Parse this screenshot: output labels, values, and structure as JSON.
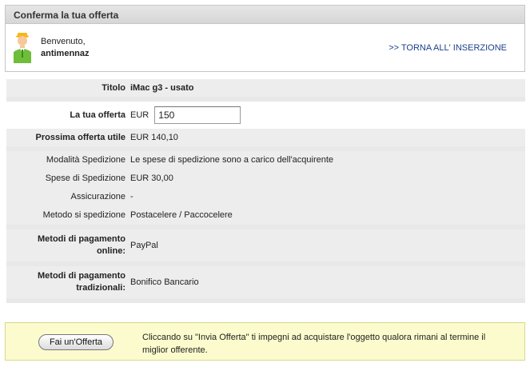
{
  "header": {
    "title": "Conferma la tua offerta"
  },
  "welcome": {
    "greeting": "Benvenuto,",
    "username": "antimennaz",
    "back_link": ">> TORNA ALL' INSERZIONE",
    "avatar_icon": "user-avatar-icon"
  },
  "details": {
    "titolo": {
      "label": "Titolo",
      "value": "iMac g3 - usato"
    },
    "offerta": {
      "label": "La tua offerta",
      "currency": "EUR",
      "input_value": "150"
    },
    "prossima": {
      "label": "Prossima offerta utile",
      "value": "EUR 140,10"
    },
    "modalita": {
      "label": "Modalità Spedizione",
      "value": "Le spese di spedizione sono a carico dell'acquirente"
    },
    "spese": {
      "label": "Spese di Spedizione",
      "value": "EUR 30,00"
    },
    "assicurazione": {
      "label": "Assicurazione",
      "value": "-"
    },
    "metodo": {
      "label": "Metodo si spedizione",
      "value": "Postacelere / Paccocelere"
    },
    "pagamento_online": {
      "label": "Metodi di pagamento online:",
      "value": "PayPal"
    },
    "pagamento_tradizionali": {
      "label": "Metodi di pagamento tradizionali:",
      "value": "Bonifico Bancario"
    }
  },
  "footer": {
    "button_label": "Fai un'Offerta",
    "text": "Cliccando su \"Invia Offerta\" ti impegni ad acquistare l'oggetto qualora rimani al termine il miglior offerente."
  },
  "colors": {
    "link": "#1d3f8c",
    "footer_bg": "#fbfbcd",
    "row_gray": "#ededed"
  }
}
